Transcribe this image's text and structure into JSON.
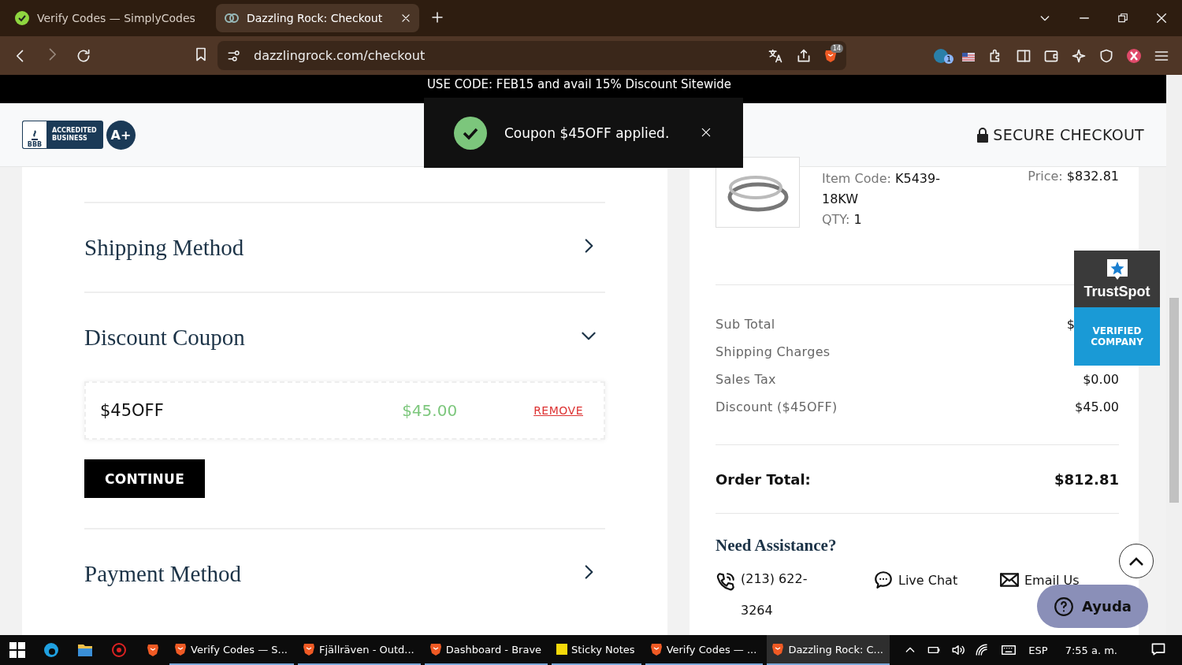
{
  "browser": {
    "tabs": [
      {
        "title": "Verify Codes — SimplyCodes",
        "selected": false
      },
      {
        "title": "Dazzling Rock: Checkout",
        "selected": true
      }
    ],
    "url": "dazzlingrock.com/checkout",
    "shields_count": "14",
    "extension_count": "1"
  },
  "promo_banner": "USE CODE: FEB15 and avail 15% Discount Sitewide",
  "toast": {
    "message": "Coupon $45OFF applied."
  },
  "header": {
    "bbb_mark": "BBB",
    "bbb_text": "ACCREDITED BUSINESS",
    "rating": "A+",
    "secure": "SECURE CHECKOUT"
  },
  "sections": [
    {
      "title": "Shipping Method",
      "expanded": false
    },
    {
      "title": "Discount Coupon",
      "expanded": true,
      "coupon": {
        "code": "$45OFF",
        "amount": "$45.00",
        "remove": "REMOVE"
      },
      "button": "CONTINUE"
    },
    {
      "title": "Payment Method",
      "expanded": false
    }
  ],
  "order": {
    "item": {
      "code_label": "Item Code:",
      "code": "K5439-18KW",
      "price_label": "Price:",
      "price": "$832.81",
      "qty_label": "QTY:",
      "qty": "1"
    },
    "summary": [
      {
        "label": "Sub Total",
        "value": "$"
      },
      {
        "label": "Shipping Charges"
      },
      {
        "label": "Sales Tax",
        "value": "$0.00"
      },
      {
        "label": "Discount ($45OFF)",
        "value": "$45.00"
      }
    ],
    "total_label": "Order Total:",
    "total": "$812.81"
  },
  "assistance": {
    "title": "Need Assistance?",
    "phone": "(213) 622-3264",
    "chat": "Live Chat",
    "email": "Email Us"
  },
  "trustspot": {
    "name": "TrustSpot",
    "badge": "VERIFIED COMPANY"
  },
  "help_button": "Ayuda",
  "taskbar": {
    "apps": [
      {
        "label": "Verify Codes — S...",
        "selected": false
      },
      {
        "label": "Fjällräven - Outd...",
        "selected": false
      },
      {
        "label": "Dashboard - Brave",
        "selected": false
      },
      {
        "label": "Sticky Notes",
        "selected": false
      },
      {
        "label": "Verify Codes — ...",
        "selected": false
      },
      {
        "label": "Dazzling Rock: C...",
        "selected": true
      }
    ],
    "language": "ESP",
    "time": "7:55 a. m."
  }
}
